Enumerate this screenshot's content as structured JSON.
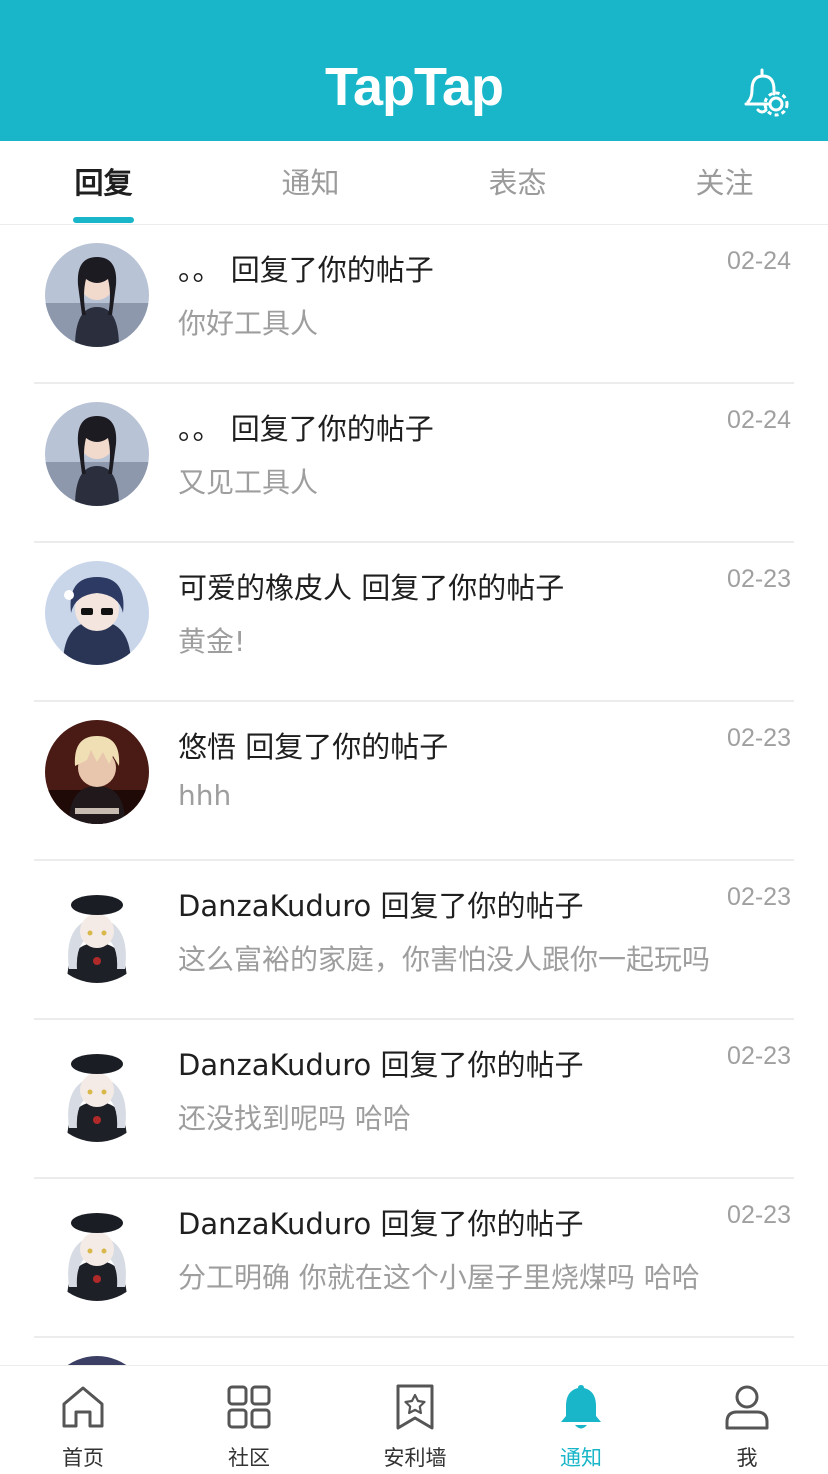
{
  "app": {
    "logo_text": "TapTap",
    "accent_color": "#18b6c8"
  },
  "header": {
    "settings_icon": "bell-settings-icon"
  },
  "tabs": [
    {
      "label": "回复",
      "active": true
    },
    {
      "label": "通知",
      "active": false
    },
    {
      "label": "表态",
      "active": false
    },
    {
      "label": "关注",
      "active": false
    }
  ],
  "replies": [
    {
      "title": "。。 回复了你的帖子",
      "date": "02-24",
      "snippet": "你好工具人",
      "avatar": "girl-photo-avatar"
    },
    {
      "title": "。。 回复了你的帖子",
      "date": "02-24",
      "snippet": "又见工具人",
      "avatar": "girl-photo-avatar"
    },
    {
      "title": "可爱的橡皮人 回复了你的帖子",
      "date": "02-23",
      "snippet": "黄金!",
      "avatar": "anime-sunglasses-avatar"
    },
    {
      "title": "悠悟 回复了你的帖子",
      "date": "02-23",
      "snippet": "hhh",
      "avatar": "anime-blond-avatar"
    },
    {
      "title": "DanzaKuduro 回复了你的帖子",
      "date": "02-23",
      "snippet": "这么富裕的家庭，你害怕没人跟你一起玩吗",
      "avatar": "anime-silver-hair-avatar"
    },
    {
      "title": "DanzaKuduro 回复了你的帖子",
      "date": "02-23",
      "snippet": "还没找到呢吗  哈哈",
      "avatar": "anime-silver-hair-avatar"
    },
    {
      "title": "DanzaKuduro 回复了你的帖子",
      "date": "02-23",
      "snippet": "分工明确  你就在这个小屋子里烧煤吗 哈哈",
      "avatar": "anime-silver-hair-avatar"
    }
  ],
  "bottom_nav": [
    {
      "label": "首页",
      "icon": "home-icon",
      "active": false
    },
    {
      "label": "社区",
      "icon": "grid-icon",
      "active": false
    },
    {
      "label": "安利墙",
      "icon": "bookmark-star-icon",
      "active": false
    },
    {
      "label": "通知",
      "icon": "bell-icon",
      "active": true
    },
    {
      "label": "我",
      "icon": "user-icon",
      "active": false
    }
  ]
}
